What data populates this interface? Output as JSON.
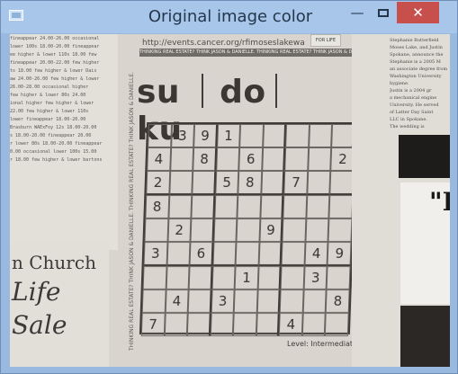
{
  "window": {
    "title": "Original image color",
    "controls": {
      "minimize": "—",
      "maximize": "",
      "close": "✕"
    }
  },
  "content": {
    "url": "http://events.cancer.org/rfimoseslakewa",
    "for_life": "FOR LIFE",
    "band_text": "THINKING REAL ESTATE? THINK JASON & DANIELLE. THINKING REAL ESTATE? THINK JASON & DANIELLE.",
    "side_text": "THINKING REAL ESTATE? THINK JASON & DANIELLE. THINKING REAL ESTATE? THINK JASON & DANIELLE.",
    "title_parts": [
      "su",
      "do",
      "ku"
    ],
    "level": "Level: Intermediate",
    "left_lines": [
      "fineappear 24.00-26.00 occasional",
      "lower 100s 18.00-20.00 fineappear",
      "ee higher & lower 110s 18.00 few",
      "fineappear 20.00-22.00 few higher",
      "ts 18.00 few higher & lower Dais",
      "aw 24.00-26.00 few higher & lower",
      "26.00-28.00 occasional higher",
      "few higher & lower 80s 24.00",
      "ional higher few higher & lower",
      "22.00 few higher & lower 110s",
      "lower fineappear 18.00-20.00",
      "Brasburn WAExFoy 12s 18.00-20.00",
      "s 18.00-20.00 fineappear 20.00",
      "r lower 80s 18.00-20.00 fineappear",
      "0.00 occasional lower 100s 15.00",
      "r 18.00 few higher & lower bartons"
    ],
    "church": "n Church",
    "life": "Life",
    "sale": "Sale",
    "right_lines": [
      "Stephanie Butterfield",
      "Moses Lake, and Justin",
      "Spokane, announce the",
      "Stephanie is a 2005 M",
      "an associate degree from",
      "Washington University",
      "hygiene.",
      "Justin is a 2004 gr",
      "a mechanical engine",
      "University. He served",
      "of Latter Day Saint",
      "LLC in Spokane.",
      "The wedding is"
    ],
    "right_big": "\"R"
  },
  "sudoku": {
    "rows": [
      [
        "",
        "3",
        "9",
        "1",
        "",
        "",
        "",
        "",
        ""
      ],
      [
        "4",
        "",
        "8",
        "",
        "6",
        "",
        "",
        "",
        "2"
      ],
      [
        "2",
        "",
        "",
        "5",
        "8",
        "",
        "7",
        "",
        ""
      ],
      [
        "8",
        "",
        "",
        "",
        "",
        "",
        "",
        "",
        ""
      ],
      [
        "",
        "2",
        "",
        "",
        "",
        "9",
        "",
        "",
        ""
      ],
      [
        "3",
        "",
        "6",
        "",
        "",
        "",
        "",
        "4",
        "9"
      ],
      [
        "",
        "",
        "",
        "",
        "1",
        "",
        "",
        "3",
        ""
      ],
      [
        "",
        "4",
        "",
        "3",
        "",
        "",
        "",
        "",
        "8"
      ],
      [
        "7",
        "",
        "",
        "",
        "",
        "",
        "4",
        "",
        ""
      ]
    ]
  }
}
